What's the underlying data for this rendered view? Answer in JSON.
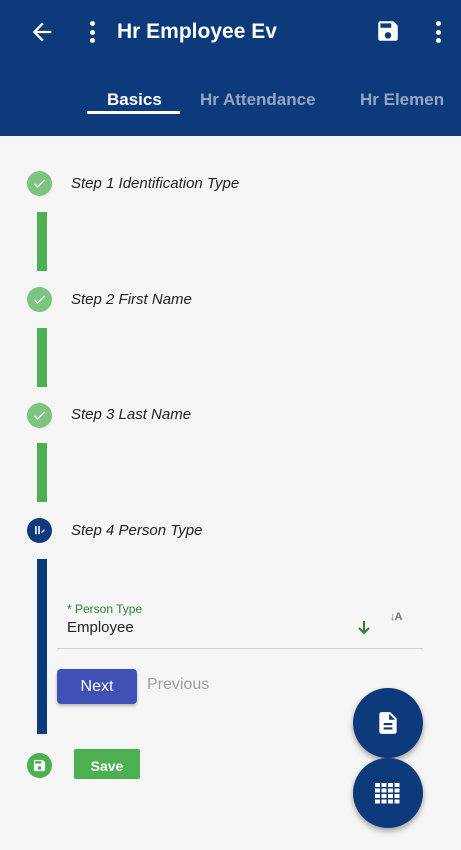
{
  "app_bar": {
    "title": "Hr Employee Ev",
    "icons": [
      "arrow-back-icon",
      "more-vert-icon",
      "save-icon",
      "more-vert-icon"
    ]
  },
  "tabs": [
    {
      "label": "Basics",
      "active": true
    },
    {
      "label": "Hr Attendance",
      "active": false
    },
    {
      "label": "Hr Elemen",
      "active": false
    }
  ],
  "steps": [
    {
      "label": "Step 1 Identification Type",
      "status": "done"
    },
    {
      "label": "Step 2 First Name",
      "status": "done"
    },
    {
      "label": "Step 3 Last Name",
      "status": "done"
    },
    {
      "label": "Step 4 Person Type",
      "status": "active"
    }
  ],
  "person_type_field": {
    "label": "* Person Type",
    "value": "Employee",
    "sort_icon_text": "↓A"
  },
  "buttons": {
    "next": "Next",
    "previous": "Previous",
    "save": "Save"
  },
  "colors": {
    "primary": "#0d3a7a",
    "step_done": "#7cc47f",
    "connector_done": "#4caf50",
    "next_button": "#3f51b5",
    "save_button": "#4caf50",
    "field_label": "#2e7d32"
  }
}
